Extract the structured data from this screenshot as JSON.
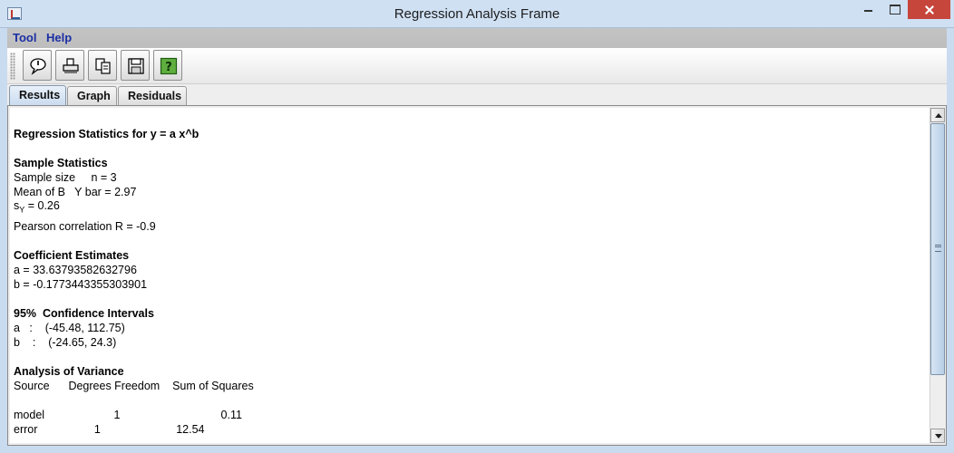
{
  "window": {
    "title": "Regression Analysis Frame"
  },
  "menu": [
    "Tool",
    "Help"
  ],
  "toolbar": {
    "buttons": [
      {
        "icon": "speech-bubble-icon"
      },
      {
        "icon": "print-icon"
      },
      {
        "icon": "copy-icon"
      },
      {
        "icon": "save-icon"
      },
      {
        "icon": "help-icon"
      }
    ]
  },
  "tabs": [
    {
      "label": "Results",
      "active": true
    },
    {
      "label": "Graph",
      "active": false
    },
    {
      "label": "Residuals",
      "active": false
    }
  ],
  "results": {
    "heading": "Regression Statistics for y = a x^b",
    "sample_title": "Sample Statistics",
    "sample_size": "Sample size     n = 3",
    "mean": "Mean of B   Y bar = 2.97",
    "sy_prefix": "s",
    "sy_sub": "Y",
    "sy_value": " = 0.26",
    "pearson": "Pearson correlation R = -0.9",
    "coef_title": "Coefficient Estimates",
    "coef_a": "a = 33.63793582632796",
    "coef_b": "b = -0.1773443355303901",
    "ci_title": "95%  Confidence Intervals",
    "ci_a": "a   :    (-45.48, 112.75)",
    "ci_b": "b    :    (-24.65, 24.3)",
    "anova_title": "Analysis of Variance",
    "anova_header": "Source      Degrees Freedom    Sum of Squares",
    "anova_model": "model                      1                                0.11",
    "anova_error": "error                  1                        12.54"
  }
}
